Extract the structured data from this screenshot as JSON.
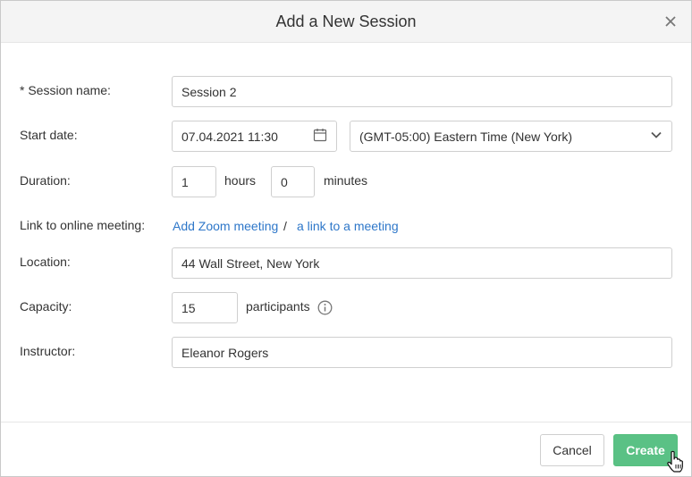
{
  "dialog": {
    "title": "Add a New Session"
  },
  "form": {
    "session_name": {
      "label": "* Session name:",
      "value": "Session 2"
    },
    "start_date": {
      "label": "Start date:",
      "value": "07.04.2021 11:30",
      "timezone": "(GMT-05:00) Eastern Time (New York)"
    },
    "duration": {
      "label": "Duration:",
      "hours_value": "1",
      "hours_unit": "hours",
      "minutes_value": "0",
      "minutes_unit": "minutes"
    },
    "online_meeting": {
      "label": "Link to online meeting:",
      "zoom_link": "Add Zoom meeting",
      "separator": "/",
      "meeting_link": "a link to a meeting"
    },
    "location": {
      "label": "Location:",
      "value": "44 Wall Street, New York"
    },
    "capacity": {
      "label": "Capacity:",
      "value": "15",
      "unit": "participants"
    },
    "instructor": {
      "label": "Instructor:",
      "value": "Eleanor Rogers"
    }
  },
  "footer": {
    "cancel_label": "Cancel",
    "create_label": "Create"
  },
  "colors": {
    "link": "#2e77c9",
    "create_button": "#5ac185",
    "header_bg": "#f4f4f4"
  },
  "icons": {
    "close": "close-icon",
    "calendar": "calendar-icon",
    "dropdown": "chevron-down-icon",
    "info": "info-icon",
    "cursor": "hand-pointer-icon"
  }
}
